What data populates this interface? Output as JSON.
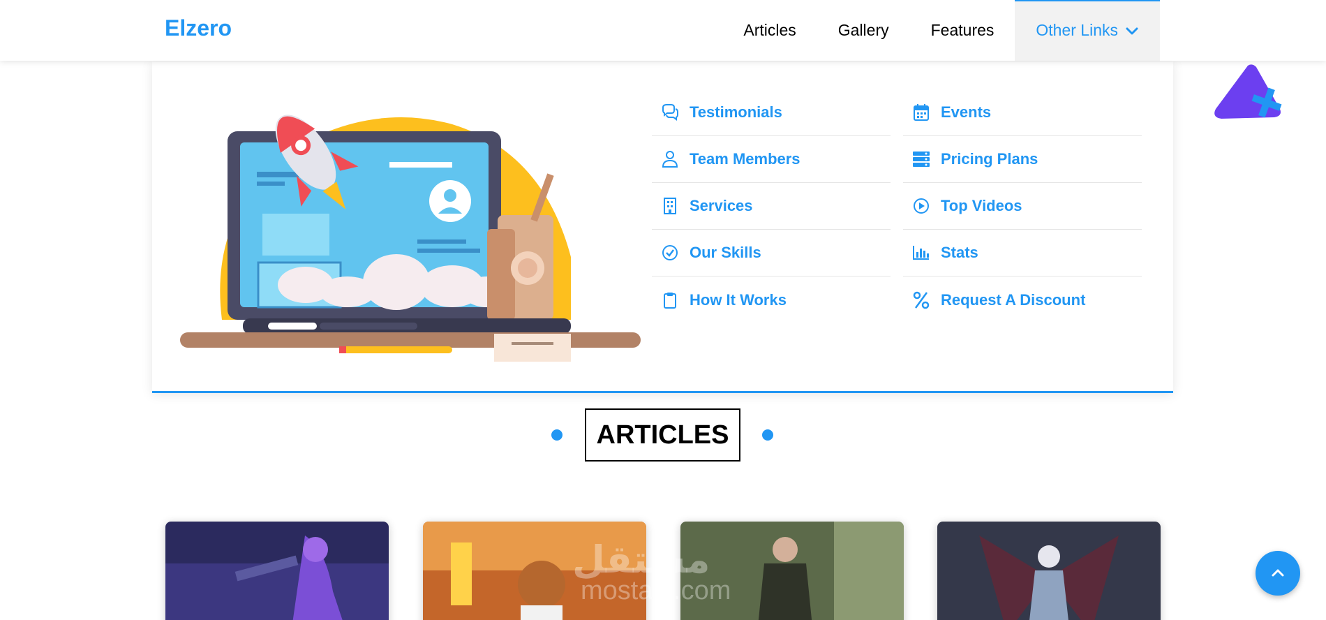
{
  "header": {
    "logo": "Elzero",
    "nav": [
      {
        "label": "Articles"
      },
      {
        "label": "Gallery"
      },
      {
        "label": "Features"
      },
      {
        "label": "Other Links",
        "active": true
      }
    ]
  },
  "mega_menu": {
    "column1": [
      {
        "label": "Testimonials",
        "icon": "comments-icon"
      },
      {
        "label": "Team Members",
        "icon": "user-icon"
      },
      {
        "label": "Services",
        "icon": "building-icon"
      },
      {
        "label": "Our Skills",
        "icon": "check-circle-icon"
      },
      {
        "label": "How It Works",
        "icon": "clipboard-icon"
      }
    ],
    "column2": [
      {
        "label": "Events",
        "icon": "calendar-icon"
      },
      {
        "label": "Pricing Plans",
        "icon": "server-icon"
      },
      {
        "label": "Top Videos",
        "icon": "play-circle-icon"
      },
      {
        "label": "Stats",
        "icon": "chart-bar-icon"
      },
      {
        "label": "Request A Discount",
        "icon": "percent-icon"
      }
    ]
  },
  "section": {
    "title": "ARTICLES"
  },
  "watermark": {
    "arabic": "مستقل",
    "latin": "mostaql.com"
  },
  "colors": {
    "accent": "#2196f3",
    "illustration_yellow": "#fdbf1e",
    "shape_purple": "#6c3ff0"
  }
}
